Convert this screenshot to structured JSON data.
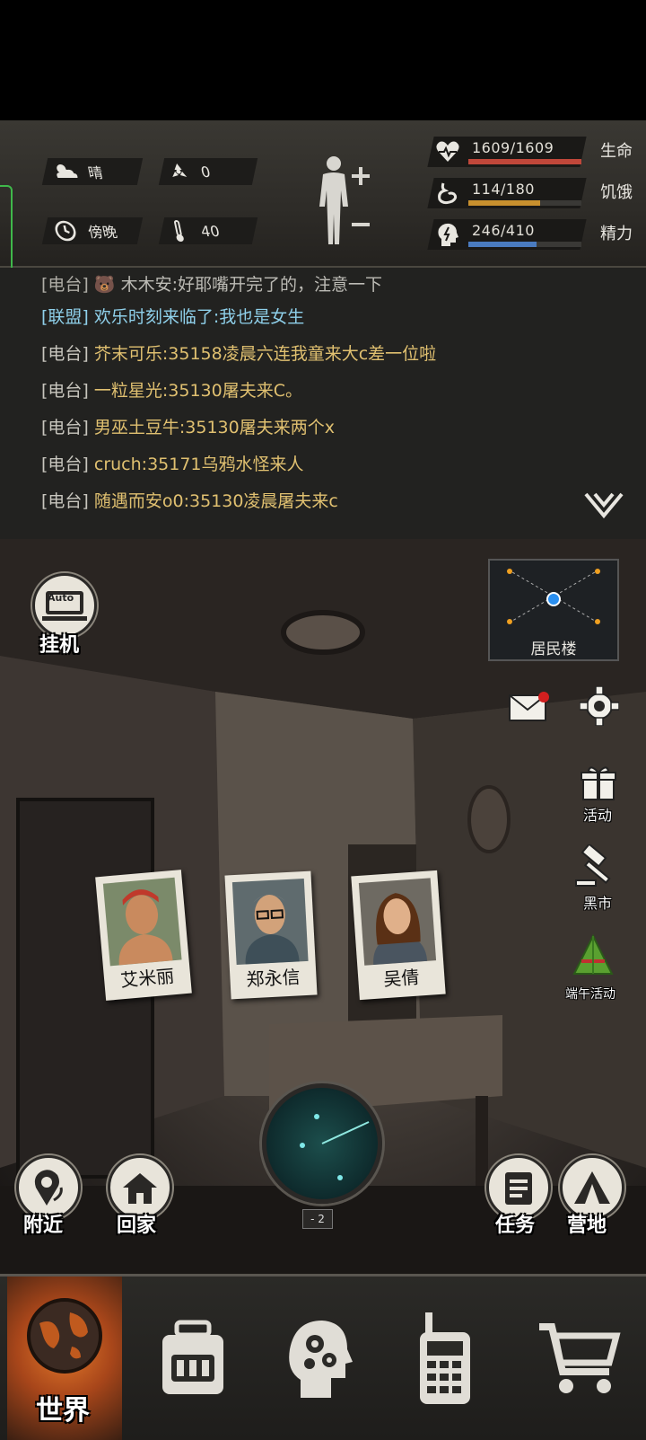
{
  "status": {
    "weather": {
      "icon": "cloudy-sun-icon",
      "label": "晴"
    },
    "radiation": {
      "icon": "radiation-icon",
      "value": "0"
    },
    "time": {
      "icon": "clock-icon",
      "label": "傍晚"
    },
    "temperature": {
      "icon": "thermometer-icon",
      "value": "40"
    },
    "stats": [
      {
        "icon": "heart-pulse-icon",
        "value": "1609/1609",
        "label": "生命",
        "fraction": 1.0,
        "color": "#c0473a"
      },
      {
        "icon": "stomach-icon",
        "value": "114/180",
        "label": "饥饿",
        "fraction": 0.633,
        "color": "#c8902e"
      },
      {
        "icon": "energy-head-icon",
        "value": "246/410",
        "label": "精力",
        "fraction": 0.6,
        "color": "#4a7bc0"
      }
    ]
  },
  "chat": {
    "messages": [
      {
        "channel": "[电台]",
        "name": "🐻",
        "text": "木木安:好耶嘴开完了的，注意一下",
        "blue": false
      },
      {
        "channel": "[联盟]",
        "name": "欢乐时刻来临了",
        "text": ":我也是女生",
        "blue": true
      },
      {
        "channel": "[电台]",
        "name": "芥末可乐",
        "text": ":35158凌晨六连我童来大c差一位啦",
        "blue": false
      },
      {
        "channel": "[电台]",
        "name": "一粒星光",
        "text": ":35130屠夫来C。",
        "blue": false
      },
      {
        "channel": "[电台]",
        "name": "男巫土豆牛",
        "text": ":35130屠夫来两个x",
        "blue": false
      },
      {
        "channel": "[电台]",
        "name": "cruch",
        "text": ":35171乌鸦水怪来人",
        "blue": false
      },
      {
        "channel": "[电台]",
        "name": "随遇而安o0",
        "text": ":35130凌晨屠夫来c",
        "blue": false
      }
    ]
  },
  "scene": {
    "auto_label": "挂机",
    "auto_badge": "Auto",
    "map_label": "居民楼",
    "activity_label": "活动",
    "market_label": "黑市",
    "festival_label": "端午活动",
    "nearby_label": "附近",
    "home_label": "回家",
    "task_label": "任务",
    "camp_label": "营地",
    "radar_count": "- 2",
    "characters": [
      {
        "name": "艾米丽",
        "bandana": "#c0392b",
        "skin": "#c98a5e",
        "hair": "#3a2518"
      },
      {
        "name": "郑永信",
        "bandana": "#555",
        "skin": "#d2a27a",
        "hair": "#888"
      },
      {
        "name": "吴倩",
        "bandana": "#6a3f25",
        "skin": "#e0b08a",
        "hair": "#5a3015"
      }
    ]
  },
  "nav": {
    "world_label": "世界",
    "items": [
      "backpack-icon",
      "brain-gears-icon",
      "walkie-talkie-icon",
      "shopping-cart-icon"
    ]
  }
}
